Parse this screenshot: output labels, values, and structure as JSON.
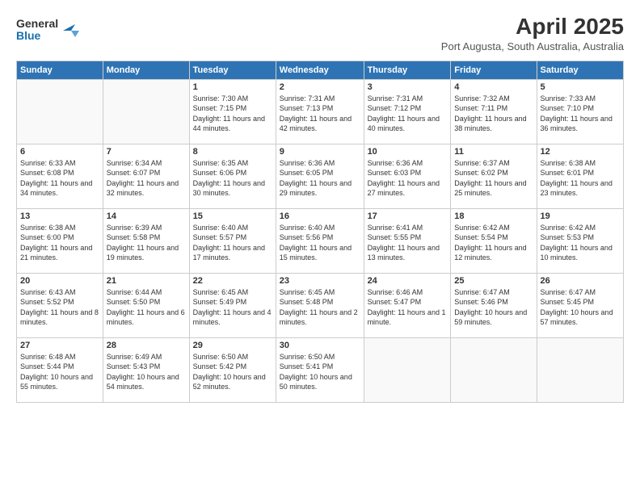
{
  "logo": {
    "line1": "General",
    "line2": "Blue"
  },
  "title": "April 2025",
  "subtitle": "Port Augusta, South Australia, Australia",
  "days_header": [
    "Sunday",
    "Monday",
    "Tuesday",
    "Wednesday",
    "Thursday",
    "Friday",
    "Saturday"
  ],
  "weeks": [
    [
      {
        "day": "",
        "info": ""
      },
      {
        "day": "",
        "info": ""
      },
      {
        "day": "1",
        "info": "Sunrise: 7:30 AM\nSunset: 7:15 PM\nDaylight: 11 hours and 44 minutes."
      },
      {
        "day": "2",
        "info": "Sunrise: 7:31 AM\nSunset: 7:13 PM\nDaylight: 11 hours and 42 minutes."
      },
      {
        "day": "3",
        "info": "Sunrise: 7:31 AM\nSunset: 7:12 PM\nDaylight: 11 hours and 40 minutes."
      },
      {
        "day": "4",
        "info": "Sunrise: 7:32 AM\nSunset: 7:11 PM\nDaylight: 11 hours and 38 minutes."
      },
      {
        "day": "5",
        "info": "Sunrise: 7:33 AM\nSunset: 7:10 PM\nDaylight: 11 hours and 36 minutes."
      }
    ],
    [
      {
        "day": "6",
        "info": "Sunrise: 6:33 AM\nSunset: 6:08 PM\nDaylight: 11 hours and 34 minutes."
      },
      {
        "day": "7",
        "info": "Sunrise: 6:34 AM\nSunset: 6:07 PM\nDaylight: 11 hours and 32 minutes."
      },
      {
        "day": "8",
        "info": "Sunrise: 6:35 AM\nSunset: 6:06 PM\nDaylight: 11 hours and 30 minutes."
      },
      {
        "day": "9",
        "info": "Sunrise: 6:36 AM\nSunset: 6:05 PM\nDaylight: 11 hours and 29 minutes."
      },
      {
        "day": "10",
        "info": "Sunrise: 6:36 AM\nSunset: 6:03 PM\nDaylight: 11 hours and 27 minutes."
      },
      {
        "day": "11",
        "info": "Sunrise: 6:37 AM\nSunset: 6:02 PM\nDaylight: 11 hours and 25 minutes."
      },
      {
        "day": "12",
        "info": "Sunrise: 6:38 AM\nSunset: 6:01 PM\nDaylight: 11 hours and 23 minutes."
      }
    ],
    [
      {
        "day": "13",
        "info": "Sunrise: 6:38 AM\nSunset: 6:00 PM\nDaylight: 11 hours and 21 minutes."
      },
      {
        "day": "14",
        "info": "Sunrise: 6:39 AM\nSunset: 5:58 PM\nDaylight: 11 hours and 19 minutes."
      },
      {
        "day": "15",
        "info": "Sunrise: 6:40 AM\nSunset: 5:57 PM\nDaylight: 11 hours and 17 minutes."
      },
      {
        "day": "16",
        "info": "Sunrise: 6:40 AM\nSunset: 5:56 PM\nDaylight: 11 hours and 15 minutes."
      },
      {
        "day": "17",
        "info": "Sunrise: 6:41 AM\nSunset: 5:55 PM\nDaylight: 11 hours and 13 minutes."
      },
      {
        "day": "18",
        "info": "Sunrise: 6:42 AM\nSunset: 5:54 PM\nDaylight: 11 hours and 12 minutes."
      },
      {
        "day": "19",
        "info": "Sunrise: 6:42 AM\nSunset: 5:53 PM\nDaylight: 11 hours and 10 minutes."
      }
    ],
    [
      {
        "day": "20",
        "info": "Sunrise: 6:43 AM\nSunset: 5:52 PM\nDaylight: 11 hours and 8 minutes."
      },
      {
        "day": "21",
        "info": "Sunrise: 6:44 AM\nSunset: 5:50 PM\nDaylight: 11 hours and 6 minutes."
      },
      {
        "day": "22",
        "info": "Sunrise: 6:45 AM\nSunset: 5:49 PM\nDaylight: 11 hours and 4 minutes."
      },
      {
        "day": "23",
        "info": "Sunrise: 6:45 AM\nSunset: 5:48 PM\nDaylight: 11 hours and 2 minutes."
      },
      {
        "day": "24",
        "info": "Sunrise: 6:46 AM\nSunset: 5:47 PM\nDaylight: 11 hours and 1 minute."
      },
      {
        "day": "25",
        "info": "Sunrise: 6:47 AM\nSunset: 5:46 PM\nDaylight: 10 hours and 59 minutes."
      },
      {
        "day": "26",
        "info": "Sunrise: 6:47 AM\nSunset: 5:45 PM\nDaylight: 10 hours and 57 minutes."
      }
    ],
    [
      {
        "day": "27",
        "info": "Sunrise: 6:48 AM\nSunset: 5:44 PM\nDaylight: 10 hours and 55 minutes."
      },
      {
        "day": "28",
        "info": "Sunrise: 6:49 AM\nSunset: 5:43 PM\nDaylight: 10 hours and 54 minutes."
      },
      {
        "day": "29",
        "info": "Sunrise: 6:50 AM\nSunset: 5:42 PM\nDaylight: 10 hours and 52 minutes."
      },
      {
        "day": "30",
        "info": "Sunrise: 6:50 AM\nSunset: 5:41 PM\nDaylight: 10 hours and 50 minutes."
      },
      {
        "day": "",
        "info": ""
      },
      {
        "day": "",
        "info": ""
      },
      {
        "day": "",
        "info": ""
      }
    ]
  ]
}
